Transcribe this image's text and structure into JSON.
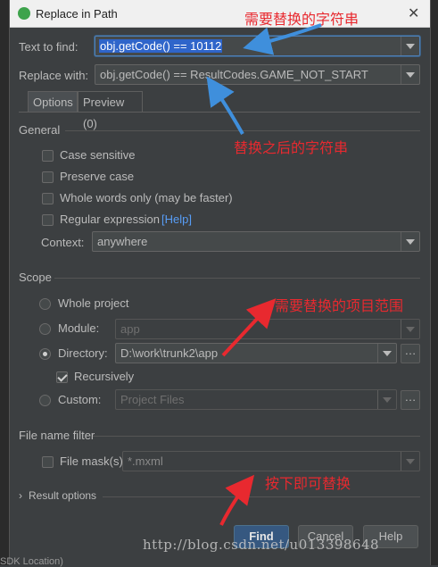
{
  "window": {
    "title": "Replace in Path",
    "close_icon": "close-icon"
  },
  "fields": {
    "find_label": "Text to find:",
    "find_value": "obj.getCode() == 10112",
    "replace_label": "Replace with:",
    "replace_value": "obj.getCode() == ResultCodes.GAME_NOT_START"
  },
  "tabs": [
    {
      "label": "Options"
    },
    {
      "label": "Preview (0)"
    }
  ],
  "general": {
    "title": "General",
    "options": [
      {
        "label": "Case sensitive",
        "checked": false
      },
      {
        "label": "Preserve case",
        "checked": false
      },
      {
        "label": "Whole words only (may be faster)",
        "checked": false
      },
      {
        "label": "Regular expression",
        "checked": false
      }
    ],
    "help_link": "[Help]",
    "context_label": "Context:",
    "context_value": "anywhere"
  },
  "scope": {
    "title": "Scope",
    "whole_project": "Whole project",
    "module_label": "Module:",
    "module_value": "app",
    "directory_label": "Directory:",
    "directory_value": "D:\\work\\trunk2\\app",
    "recursively": "Recursively",
    "custom_label": "Custom:",
    "custom_value": "Project Files",
    "selected": "directory"
  },
  "filter": {
    "title": "File name filter",
    "mask_label": "File mask(s)",
    "mask_value": "*.mxml"
  },
  "result_options": "Result options",
  "buttons": {
    "find": "Find",
    "cancel": "Cancel",
    "help": "Help"
  },
  "annotations": {
    "find_note": "需要替换的字符串",
    "replace_note": "替换之后的字符串",
    "scope_note": "需要替换的项目范围",
    "button_note": "按下即可替换"
  },
  "watermark": "http://blog.csdn.net/u013398648",
  "status_fragment": "SDK Location)",
  "colors": {
    "annotation": "#e8292f",
    "arrow": "#3f8fdc",
    "primary_button": "#365880"
  }
}
